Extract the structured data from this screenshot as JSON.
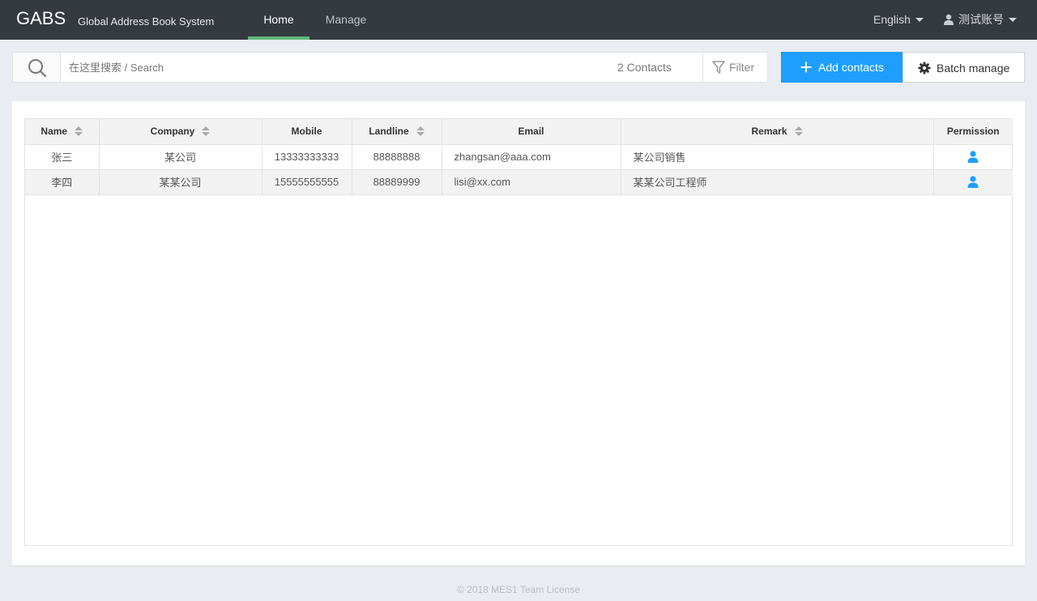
{
  "navbar": {
    "brand": "GABS",
    "subtitle": "Global Address Book System",
    "links": [
      {
        "label": "Home",
        "active": true
      },
      {
        "label": "Manage",
        "active": false
      }
    ],
    "language": "English",
    "user": "测试账号"
  },
  "toolbar": {
    "search_placeholder": "在这里搜索 / Search",
    "contacts_count": "2 Contacts",
    "filter_label": "Filter",
    "add_label": "Add contacts",
    "batch_label": "Batch manage"
  },
  "table": {
    "columns": [
      {
        "label": "Name",
        "sortable": true
      },
      {
        "label": "Company",
        "sortable": true
      },
      {
        "label": "Mobile",
        "sortable": false
      },
      {
        "label": "Landline",
        "sortable": true
      },
      {
        "label": "Email",
        "sortable": false
      },
      {
        "label": "Remark",
        "sortable": true
      },
      {
        "label": "Permission",
        "sortable": false
      }
    ],
    "rows": [
      {
        "name": "张三",
        "company": "某公司",
        "mobile": "13333333333",
        "landline": "88888888",
        "email": "zhangsan@aaa.com",
        "remark": "某公司销售",
        "permission_icon": "user-icon"
      },
      {
        "name": "李四",
        "company": "某某公司",
        "mobile": "15555555555",
        "landline": "88889999",
        "email": "lisi@xx.com",
        "remark": "某某公司工程师",
        "permission_icon": "user-icon"
      }
    ]
  },
  "footer": {
    "text": "© 2018 MES1 Team License"
  },
  "colors": {
    "navbar_bg": "#353a40",
    "active_underline": "#5fb878",
    "primary_button": "#1e9fff",
    "permission_icon": "#1e9fff",
    "page_bg": "#e9ecf0"
  }
}
